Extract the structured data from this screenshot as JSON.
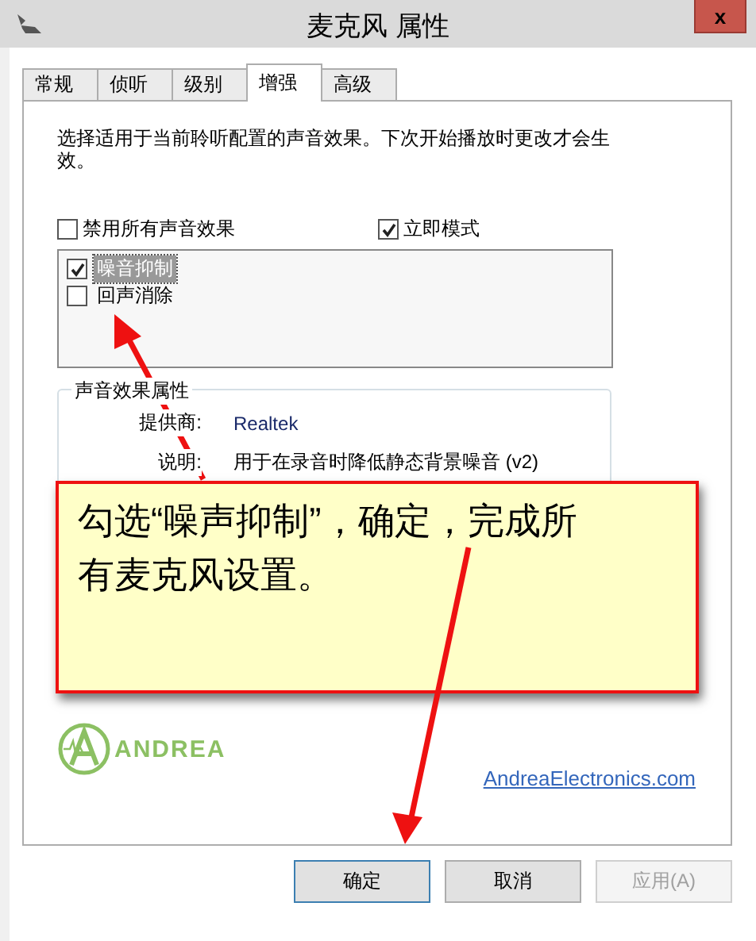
{
  "window": {
    "title": "麦克风 属性",
    "close": "x"
  },
  "tabs": [
    {
      "label": "常规",
      "selected": false
    },
    {
      "label": "侦听",
      "selected": false
    },
    {
      "label": "级别",
      "selected": false
    },
    {
      "label": "增强",
      "selected": true
    },
    {
      "label": "高级",
      "selected": false
    }
  ],
  "description": "选择适用于当前聆听配置的声音效果。下次开始播放时更改才会生效。",
  "options": [
    {
      "label": "禁用所有声音效果",
      "checked": false
    },
    {
      "label": "立即模式",
      "checked": true
    }
  ],
  "effects": [
    {
      "label": "噪音抑制",
      "checked": true,
      "selected": true
    },
    {
      "label": "回声消除",
      "checked": false,
      "selected": false
    }
  ],
  "properties": {
    "title": "声音效果属性",
    "rows": [
      {
        "label": "提供商:",
        "value": "Realtek"
      },
      {
        "label": "说明:",
        "value": "用于在录音时降低静态背景噪音 (v2)"
      }
    ]
  },
  "logo": {
    "text": "ANDREA"
  },
  "link": "AndreaElectronics.com",
  "buttons": [
    {
      "label": "确定",
      "default": true,
      "disabled": false
    },
    {
      "label": "取消",
      "default": false,
      "disabled": false
    },
    {
      "label": "应用(A)",
      "default": false,
      "disabled": true
    }
  ],
  "annotation": {
    "text": "勾选“噪声抑制”，确定，完成所有麦克风设置。"
  }
}
